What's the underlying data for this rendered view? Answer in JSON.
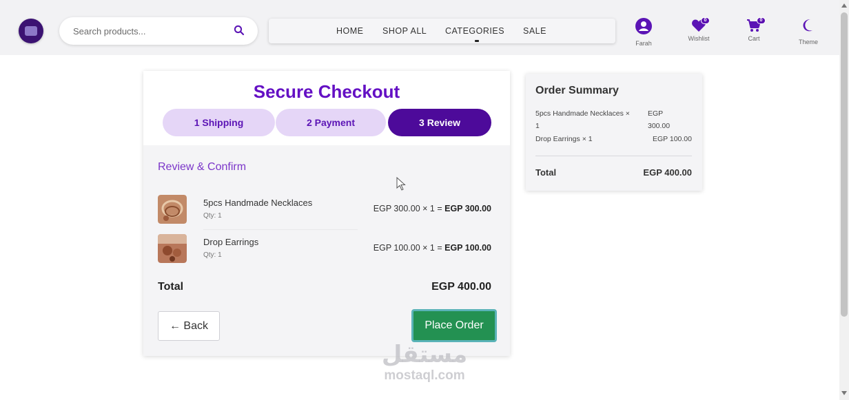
{
  "header": {
    "search_placeholder": "Search products...",
    "nav": [
      "HOME",
      "SHOP ALL",
      "CATEGORIES",
      "SALE"
    ],
    "user_label": "Farah",
    "wishlist_label": "Wishlist",
    "wishlist_count": "0",
    "cart_label": "Cart",
    "cart_count": "0",
    "theme_label": "Theme"
  },
  "checkout": {
    "title": "Secure Checkout",
    "steps": [
      {
        "label": "1 Shipping",
        "active": false
      },
      {
        "label": "2 Payment",
        "active": false
      },
      {
        "label": "3 Review",
        "active": true
      }
    ],
    "section_title": "Review & Confirm",
    "items": [
      {
        "name": "5pcs Handmade Necklaces",
        "qty": "Qty: 1",
        "price_calc": "EGP 300.00 × 1 = ",
        "line_total": "EGP 300.00"
      },
      {
        "name": "Drop Earrings",
        "qty": "Qty: 1",
        "price_calc": "EGP 100.00 × 1 = ",
        "line_total": "EGP 100.00"
      }
    ],
    "total_label": "Total",
    "total_value": "EGP 400.00",
    "back_label": "← Back",
    "place_order_label": "Place Order"
  },
  "summary": {
    "title": "Order Summary",
    "line1_name": "5pcs Handmade Necklaces ×",
    "line1_qty": "1",
    "line1_price_a": "EGP",
    "line1_price_b": "300.00",
    "line2_name": "Drop Earrings × 1",
    "line2_price": "EGP 100.00",
    "total_label": "Total",
    "total_value": "EGP 400.00"
  },
  "watermark": {
    "arabic": "مستقل",
    "latin": "mostaql.com"
  },
  "colors": {
    "accent": "#6410c4",
    "step_active": "#4d0a9a",
    "step_inactive": "#e5d6f7",
    "place_order": "#239152"
  }
}
